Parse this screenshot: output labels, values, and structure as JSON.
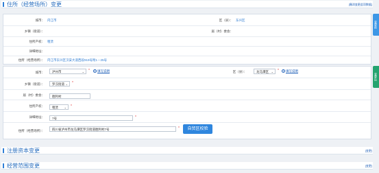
{
  "sections": {
    "address": {
      "title": "住所（经营场所）变更",
      "action": "[撤消变更此项数据]"
    },
    "capital": {
      "title": "注册资本变更",
      "action": "[变更]"
    },
    "scope": {
      "title": "经营范围变更",
      "action": "[变更]"
    }
  },
  "old": {
    "city_label": "城市：",
    "city_value": "内江市",
    "district_label": "区（县）：",
    "district_value": "东兴区",
    "town_label": "乡镇（街道）：",
    "town_value": "",
    "village_label": "居（村）委会：",
    "village_value": "",
    "ownership_label": "住所产权：",
    "ownership_value": "租赁",
    "detail_label": "详细地址：",
    "detail_value": "",
    "address_label": "住所（经营场所）：",
    "address_value": "内江市东兴区汉安大道西段919号附1－25号"
  },
  "new": {
    "city_label": "城市：",
    "city_value": "泸州市",
    "city_help": "填写说明",
    "district_label": "区（县）：",
    "district_value": "龙马潭区",
    "district_help": "填写说明",
    "town_label": "乡镇（街道）：",
    "town_value": "罗汉街道",
    "village_label": "居（村）委会：",
    "village_value": "胜利村",
    "ownership_label": "住所产权：",
    "ownership_value": "租赁",
    "detail_label": "详细地址：",
    "detail_value": "7号",
    "address_label": "住所（经营场所）：",
    "address_value": "四川省泸州市龙马潭区罗汉街道胜利村7号",
    "verify_button": "自贸区校验"
  },
  "side_tabs": {
    "top": "变更前",
    "bottom": "变更后"
  }
}
